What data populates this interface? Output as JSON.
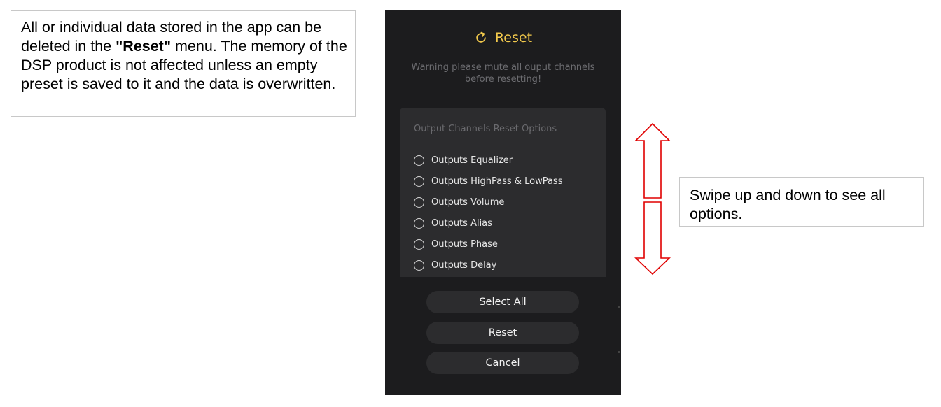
{
  "callout_left": {
    "part1": "All or individual data stored in the app can be deleted in the ",
    "bold": "\"Reset\"",
    "part2": " menu. The memory of the DSP product is not affected unless an empty preset is saved to it and the data is overwritten."
  },
  "callout_right": {
    "text": "Swipe up and down to see all options."
  },
  "app": {
    "title": "Reset",
    "title_icon": "refresh-icon",
    "accent_color": "#f2c94c",
    "background_color": "#1c1c1e",
    "warning": "Warning please mute all ouput channels before resetting!",
    "options_heading": "Output Channels Reset Options",
    "options": [
      {
        "label": "Outputs Equalizer",
        "selected": false
      },
      {
        "label": "Outputs HighPass & LowPass",
        "selected": false
      },
      {
        "label": "Outputs Volume",
        "selected": false
      },
      {
        "label": "Outputs Alias",
        "selected": false
      },
      {
        "label": "Outputs Phase",
        "selected": false
      },
      {
        "label": "Outputs Delay",
        "selected": false
      }
    ],
    "buttons": {
      "select_all": "Select All",
      "reset": "Reset",
      "cancel": "Cancel"
    }
  },
  "annotation": {
    "arrow_icon": "up-down-arrow-icon",
    "arrow_color": "#e00000"
  }
}
